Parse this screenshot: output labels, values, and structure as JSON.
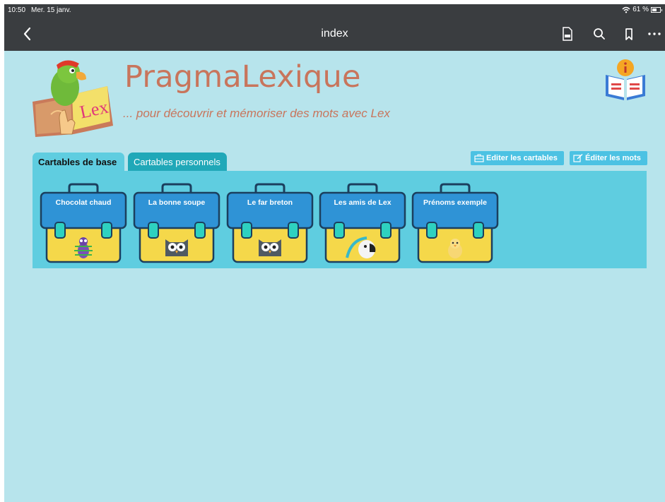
{
  "status_bar": {
    "time": "10:50",
    "date": "Mer. 15 janv.",
    "battery": "61 %",
    "battery_level": 0.61
  },
  "nav": {
    "title": "index"
  },
  "app": {
    "title": "PragmaLexique",
    "subtitle": "... pour découvrir et mémoriser des mots avec Lex",
    "logo_text": "Lex"
  },
  "tabs": [
    {
      "label": "Cartables de base",
      "active": true
    },
    {
      "label": "Cartables personnels",
      "active": false
    }
  ],
  "actions": {
    "edit_cartables": "Editer les cartables",
    "edit_words": "Éditer les mots"
  },
  "cartables": [
    {
      "label": "Chocolat chaud",
      "mascot": "bug-icon"
    },
    {
      "label": "La bonne soupe",
      "mascot": "owl-icon"
    },
    {
      "label": "Le far breton",
      "mascot": "owl-icon"
    },
    {
      "label": "Les amis de Lex",
      "mascot": "parrot-icon"
    },
    {
      "label": "Prénoms exemple",
      "mascot": "chick-icon"
    }
  ],
  "colors": {
    "page_bg": "#b7e4ec",
    "bar_bg": "#3a3d40",
    "title": "#c8755c",
    "panel": "#5fcde0",
    "tab_inactive": "#20a8b8",
    "case_blue": "#2f93d6",
    "case_yellow": "#f5d84a",
    "button": "#4cc2e3"
  }
}
